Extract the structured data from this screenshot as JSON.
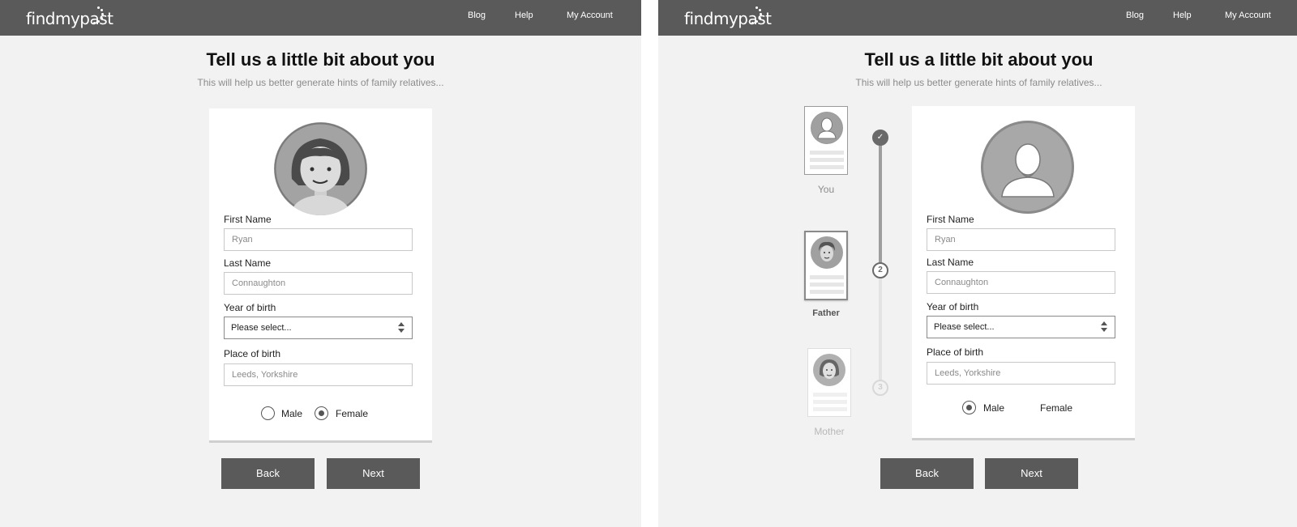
{
  "brand": {
    "logo_text": "findmypast"
  },
  "nav": {
    "blog": "Blog",
    "help": "Help",
    "account": "My Account"
  },
  "heading": {
    "title": "Tell us a little bit about you",
    "subtitle": "This will help us better generate hints of family relatives..."
  },
  "left_form": {
    "first_name_label": "First Name",
    "first_name_value": "Ryan",
    "last_name_label": "Last Name",
    "last_name_value": "Connaughton",
    "year_label": "Year of birth",
    "year_value": "Please select...",
    "place_label": "Place of birth",
    "place_value": "Leeds, Yorkshire",
    "gender_options": [
      "Male",
      "Female"
    ],
    "gender_selected": "Female"
  },
  "right_form": {
    "first_name_label": "First Name",
    "first_name_value": "Ryan",
    "last_name_label": "Last Name",
    "last_name_value": "Connaughton",
    "year_label": "Year of birth",
    "year_value": "Please select...",
    "place_label": "Place of birth",
    "place_value": "Leeds, Yorkshire",
    "gender_options": [
      "Male",
      "Female"
    ],
    "gender_selected": "Male"
  },
  "steps": [
    {
      "label": "You",
      "state": "done",
      "marker": "✓"
    },
    {
      "label": "Father",
      "state": "current",
      "marker": "2"
    },
    {
      "label": "Mother",
      "state": "future",
      "marker": "3"
    }
  ],
  "buttons": {
    "back": "Back",
    "next": "Next"
  },
  "colors": {
    "topbar": "#5a5a5a",
    "background": "#f2f2f2",
    "button": "#5a5a5a"
  }
}
